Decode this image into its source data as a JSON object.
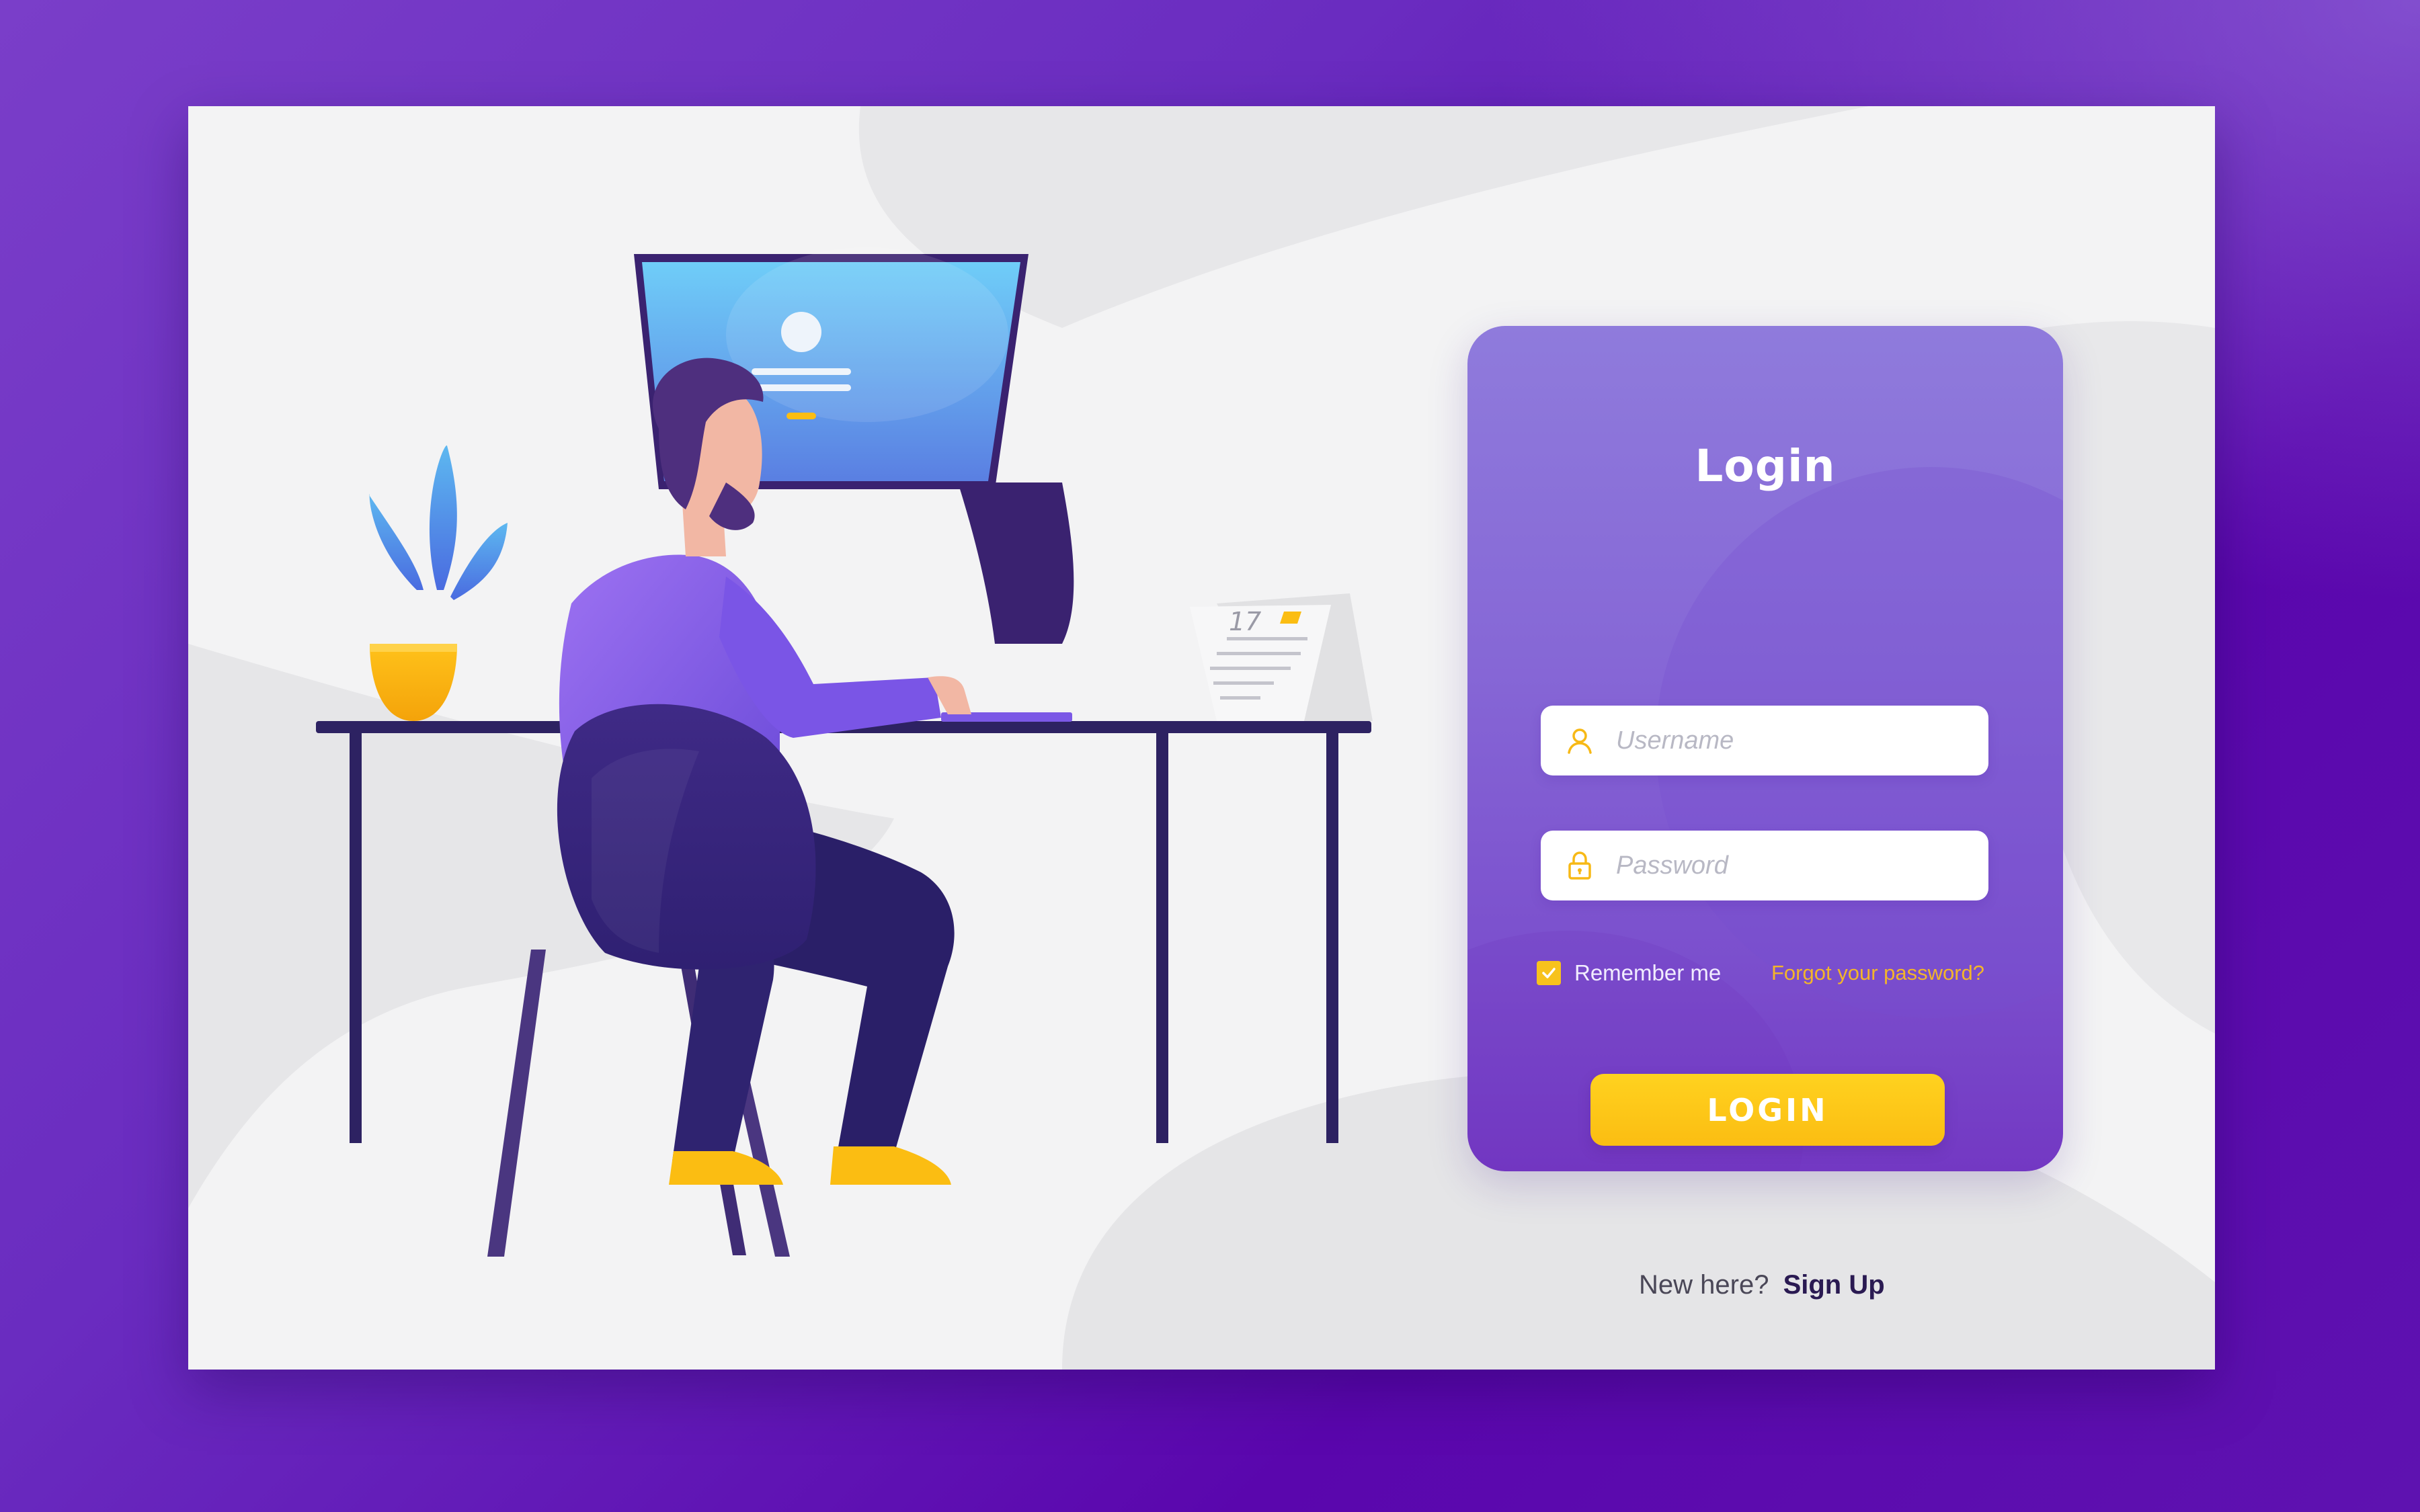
{
  "login": {
    "title": "Login",
    "username_placeholder": "Username",
    "password_placeholder": "Password",
    "remember_label": "Remember me",
    "remember_checked": true,
    "forgot_label": "Forgot your password?",
    "button_label": "LOGIN"
  },
  "signup": {
    "prompt": "New here?",
    "link_label": "Sign Up"
  },
  "illustration": {
    "calendar_day": "17"
  },
  "icons": {
    "username": "user-icon",
    "password": "lock-icon",
    "checkbox": "checkmark-icon"
  },
  "colors": {
    "background": "#6a2cc0",
    "panel": "#8667d6",
    "accent": "#fbbd12",
    "forgot_link": "#f3b52a",
    "signup_link": "#2a1a52"
  }
}
